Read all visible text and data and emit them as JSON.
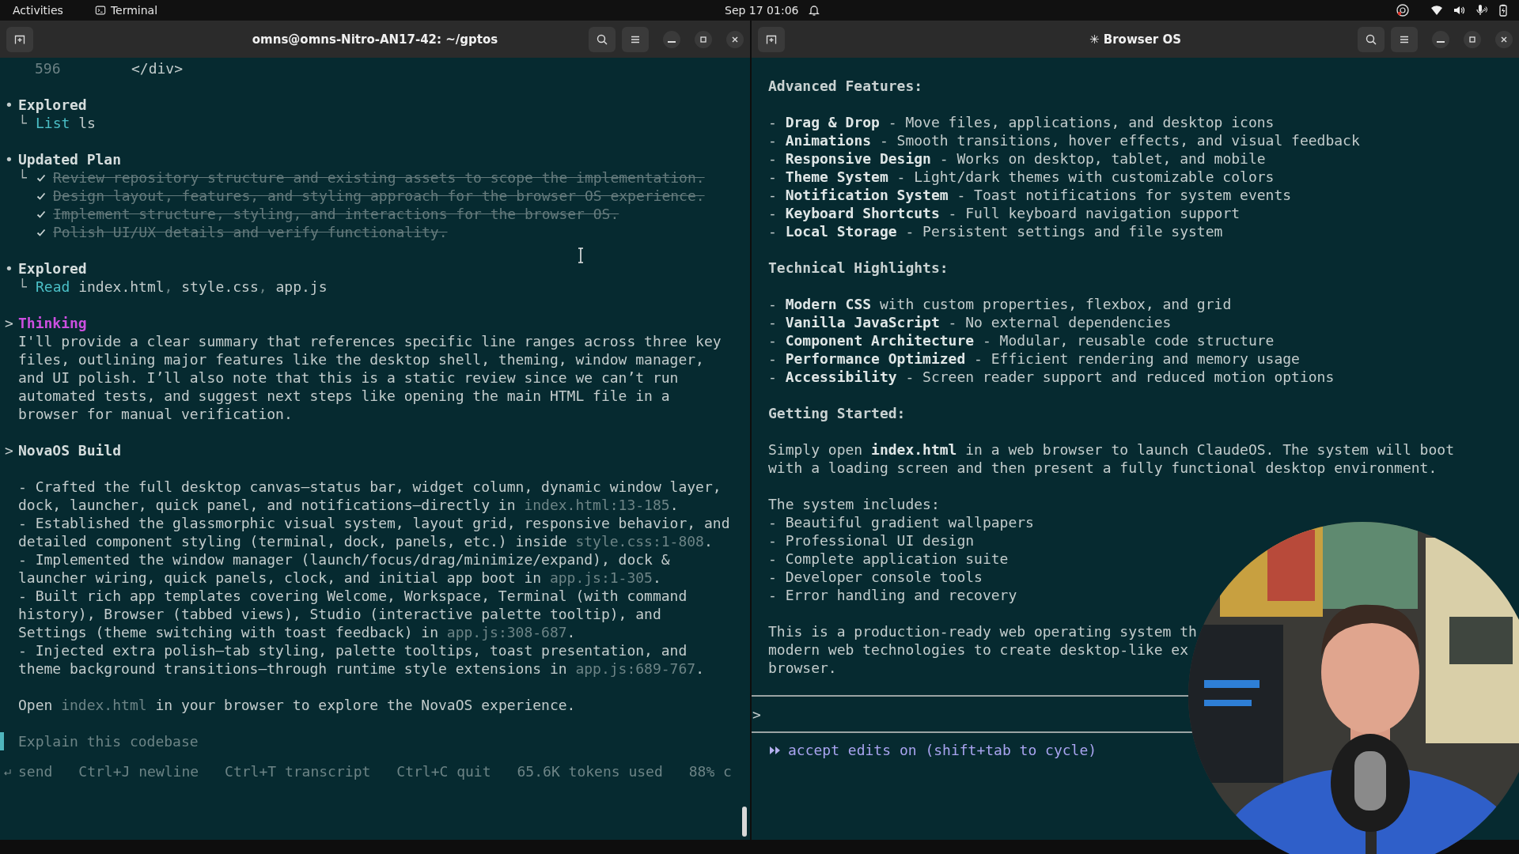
{
  "top_bar": {
    "activities": "Activities",
    "app": "Terminal",
    "clock": "Sep 17  01:06"
  },
  "left_window": {
    "title": "omns@omns-Nitro-AN17-42: ~/gptos",
    "code_line": {
      "number": "596",
      "code": "</div>"
    },
    "sections": [
      {
        "kind": "explored",
        "marker": "•",
        "title": "Explored",
        "branch": "└",
        "lines": [
          [
            {
              "text": "List",
              "kind": "cmd"
            },
            {
              "text": " ls"
            }
          ]
        ]
      },
      {
        "kind": "plan",
        "marker": "•",
        "title": "Updated Plan",
        "branch": "└",
        "tasks": [
          {
            "text": "Review repository structure and existing assets to scope the implementation.",
            "done": true
          },
          {
            "text": "Design layout, features, and styling approach for the browser OS experience.",
            "done": true
          },
          {
            "text": "Implement structure, styling, and interactions for the browser OS.",
            "done": true
          },
          {
            "text": "Polish UI/UX details and verify functionality.",
            "done": true
          }
        ]
      },
      {
        "kind": "explored",
        "marker": "•",
        "title": "Explored",
        "branch": "└",
        "lines": [
          [
            {
              "text": "Read",
              "kind": "cmd"
            },
            {
              "text": " index.html"
            },
            {
              "text": ",",
              "kind": "dim"
            },
            {
              "text": " style.css"
            },
            {
              "text": ",",
              "kind": "dim"
            },
            {
              "text": " app.js"
            }
          ]
        ]
      },
      {
        "kind": "thinking",
        "marker": ">",
        "title": "Thinking",
        "lines": [
          "I'll provide a clear summary that references specific line ranges across three key",
          "files, outlining major features like the desktop shell, theming, window manager,",
          "and UI polish. I’ll also note that this is a static review since we can’t run",
          "automated tests, and suggest next steps like opening the main HTML file in a",
          "browser for manual verification."
        ]
      },
      {
        "kind": "report",
        "marker": ">",
        "title": "NovaOS Build",
        "bullets": [
          [
            [
              {
                "text": "- Crafted the full desktop canvas—status bar, widget column, dynamic window layer,"
              }
            ],
            [
              {
                "text": "dock, launcher, quick panel, and notifications—directly in "
              },
              {
                "text": "index.html:13-185",
                "kind": "ref"
              },
              {
                "text": "."
              }
            ]
          ],
          [
            [
              {
                "text": "- Established the glassmorphic visual system, layout grid, responsive behavior, and"
              }
            ],
            [
              {
                "text": "detailed component styling (terminal, dock, panels, etc.) inside "
              },
              {
                "text": "style.css:1-808",
                "kind": "ref"
              },
              {
                "text": "."
              }
            ]
          ],
          [
            [
              {
                "text": "- Implemented the window manager (launch/focus/drag/minimize/expand), dock &"
              }
            ],
            [
              {
                "text": "launcher wiring, quick panels, clock, and initial app boot in "
              },
              {
                "text": "app.js:1-305",
                "kind": "ref"
              },
              {
                "text": "."
              }
            ]
          ],
          [
            [
              {
                "text": "- Built rich app templates covering Welcome, Workspace, Terminal (with command"
              }
            ],
            [
              {
                "text": "history), Browser (tabbed views), Studio (interactive palette tooltip), and"
              }
            ],
            [
              {
                "text": "Settings (theme switching with toast feedback) in "
              },
              {
                "text": "app.js:308-687",
                "kind": "ref"
              },
              {
                "text": "."
              }
            ]
          ],
          [
            [
              {
                "text": "- Injected extra polish—tab styling, palette tooltips, toast presentation, and"
              }
            ],
            [
              {
                "text": "theme background transitions—through runtime style extensions in "
              },
              {
                "text": "app.js:689-767",
                "kind": "ref"
              },
              {
                "text": "."
              }
            ]
          ]
        ],
        "closing": [
          {
            "text": "Open "
          },
          {
            "text": "index.html",
            "kind": "ref"
          },
          {
            "text": " in your browser to explore the NovaOS experience."
          }
        ]
      }
    ],
    "prompt": {
      "placeholder": "Explain this codebase"
    },
    "hints": [
      "send",
      "Ctrl+J newline",
      "Ctrl+T transcript",
      "Ctrl+C quit",
      "65.6K tokens used",
      "88% c"
    ]
  },
  "right_window": {
    "title": "✳ Browser OS",
    "blocks": [
      {
        "kind": "heading",
        "text": "Advanced Features:"
      },
      {
        "kind": "list",
        "items": [
          "- **Drag & Drop** - Move files, applications, and desktop icons",
          "- **Animations** - Smooth transitions, hover effects, and visual feedback",
          "- **Responsive Design** - Works on desktop, tablet, and mobile",
          "- **Theme System** - Light/dark themes with customizable colors",
          "- **Notification System** - Toast notifications for system events",
          "- **Keyboard Shortcuts** - Full keyboard navigation support",
          "- **Local Storage** - Persistent settings and file system"
        ]
      },
      {
        "kind": "heading",
        "text": "Technical Highlights:"
      },
      {
        "kind": "list",
        "items": [
          "- **Modern CSS** with custom properties, flexbox, and grid",
          "- **Vanilla JavaScript** - No external dependencies",
          "- **Component Architecture** - Modular, reusable code structure",
          "- **Performance Optimized** - Efficient rendering and memory usage",
          "- **Accessibility** - Screen reader support and reduced motion options"
        ]
      },
      {
        "kind": "heading",
        "text": "Getting Started:"
      },
      {
        "kind": "paragraph",
        "lines": [
          "Simply open **index.html** in a web browser to launch ClaudeOS. The system will boot",
          "with a loading screen and then present a fully functional desktop environment."
        ]
      },
      {
        "kind": "list",
        "intro": "The system includes:",
        "items": [
          "- Beautiful gradient wallpapers",
          "- Professional UI design",
          "- Complete application suite",
          "- Developer console tools",
          "- Error handling and recovery"
        ]
      },
      {
        "kind": "paragraph",
        "lines": [
          "This is a production-ready web operating system th",
          "modern web technologies to create desktop-like ex",
          "browser."
        ]
      }
    ],
    "prompt": {
      "symbol": ">"
    },
    "mode": "accept edits on (shift+tab to cycle)"
  }
}
